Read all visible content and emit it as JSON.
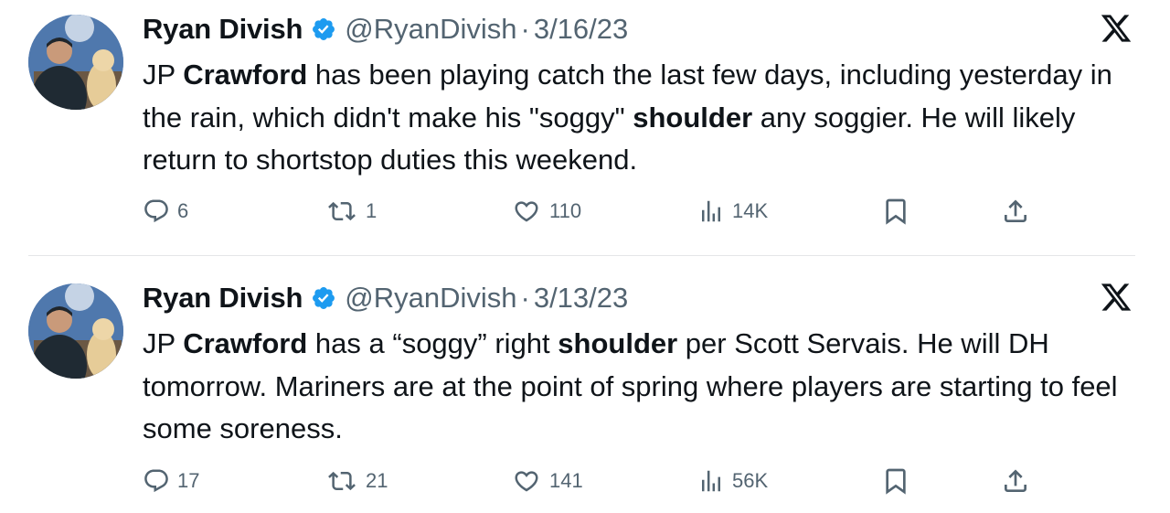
{
  "tweets": [
    {
      "author_name": "Ryan Divish",
      "handle": "@RyanDivish",
      "separator": "·",
      "date": "3/16/23",
      "text_segments": [
        {
          "text": "JP ",
          "bold": false
        },
        {
          "text": "Crawford",
          "bold": true
        },
        {
          "text": " has been playing catch the last few days, including yesterday in the rain, which didn't make his \"soggy\" ",
          "bold": false
        },
        {
          "text": "shoulder",
          "bold": true
        },
        {
          "text": " any soggier. He will likely return to shortstop duties this weekend.",
          "bold": false
        }
      ],
      "replies": "6",
      "retweets": "1",
      "likes": "110",
      "views": "14K"
    },
    {
      "author_name": "Ryan Divish",
      "handle": "@RyanDivish",
      "separator": "·",
      "date": "3/13/23",
      "text_segments": [
        {
          "text": "JP ",
          "bold": false
        },
        {
          "text": "Crawford",
          "bold": true
        },
        {
          "text": " has a “soggy” right ",
          "bold": false
        },
        {
          "text": "shoulder",
          "bold": true
        },
        {
          "text": " per Scott Servais. He will DH tomorrow. Mariners are at the point of spring where players are starting to feel some soreness.",
          "bold": false
        }
      ],
      "replies": "17",
      "retweets": "21",
      "likes": "141",
      "views": "56K"
    }
  ],
  "icons": {
    "verified": "verified-badge-icon",
    "platform": "x-logo-icon",
    "reply": "reply-icon",
    "retweet": "retweet-icon",
    "like": "heart-icon",
    "views": "views-icon",
    "bookmark": "bookmark-icon",
    "share": "share-icon"
  },
  "colors": {
    "verified": "#1d9bf0",
    "text": "#0f1419",
    "secondary": "#536471",
    "divider": "#e4e6e8"
  }
}
